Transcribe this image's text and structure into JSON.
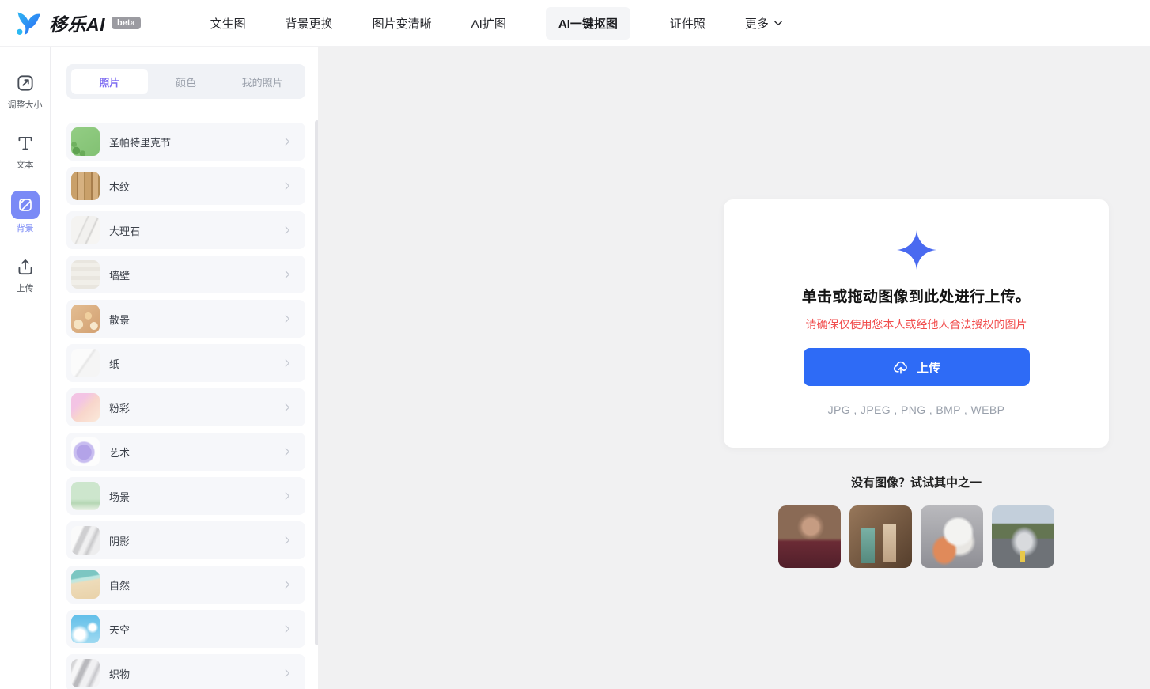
{
  "colors": {
    "accent_blue": "#2e6bf6",
    "sidebar_active_blue": "#7a8af6",
    "tab_active_purple": "#7f6ef2",
    "warning_red": "#f14c4c",
    "canvas_bg": "#f1f1f2"
  },
  "header": {
    "logo": {
      "text": "移乐AI",
      "badge": "beta",
      "icon": "logo-bird-icon"
    },
    "nav": [
      {
        "label": "文生图",
        "active": false
      },
      {
        "label": "背景更换",
        "active": false
      },
      {
        "label": "图片变清晰",
        "active": false
      },
      {
        "label": "AI扩图",
        "active": false
      },
      {
        "label": "AI一键抠图",
        "active": true
      },
      {
        "label": "证件照",
        "active": false
      },
      {
        "label": "更多",
        "active": false,
        "dropdown_icon": "chevron-down-icon"
      }
    ]
  },
  "sidebar": {
    "items": [
      {
        "label": "调整大小",
        "icon": "resize-icon",
        "active": false
      },
      {
        "label": "文本",
        "icon": "text-icon",
        "active": false
      },
      {
        "label": "背景",
        "icon": "background-icon",
        "active": true
      },
      {
        "label": "上传",
        "icon": "upload-icon",
        "active": false
      }
    ]
  },
  "panel": {
    "tabs": [
      {
        "label": "照片",
        "active": true
      },
      {
        "label": "颜色",
        "active": false
      },
      {
        "label": "我的照片",
        "active": false
      }
    ],
    "categories": [
      {
        "label": "圣帕特里克节",
        "thumb": "st-patricks-clover"
      },
      {
        "label": "木纹",
        "thumb": "wood-grain"
      },
      {
        "label": "大理石",
        "thumb": "marble"
      },
      {
        "label": "墙壁",
        "thumb": "wall"
      },
      {
        "label": "散景",
        "thumb": "bokeh"
      },
      {
        "label": "纸",
        "thumb": "paper"
      },
      {
        "label": "粉彩",
        "thumb": "pastel"
      },
      {
        "label": "艺术",
        "thumb": "art"
      },
      {
        "label": "场景",
        "thumb": "scene"
      },
      {
        "label": "阴影",
        "thumb": "shadow"
      },
      {
        "label": "自然",
        "thumb": "nature-beach"
      },
      {
        "label": "天空",
        "thumb": "sky"
      },
      {
        "label": "织物",
        "thumb": "fabric"
      }
    ]
  },
  "uploader": {
    "title": "单击或拖动图像到此处进行上传。",
    "warning": "请确保仅使用您本人或经他人合法授权的图片",
    "button_label": "上传",
    "formats": "JPG , JPEG , PNG , BMP , WEBP",
    "icon": "sparkle-plus-icon",
    "button_icon": "cloud-upload-icon"
  },
  "samples": {
    "title": "没有图像？试试其中之一",
    "items": [
      {
        "name": "portrait-woman"
      },
      {
        "name": "cosmetic-bottles"
      },
      {
        "name": "sneaker"
      },
      {
        "name": "sports-car"
      }
    ]
  }
}
